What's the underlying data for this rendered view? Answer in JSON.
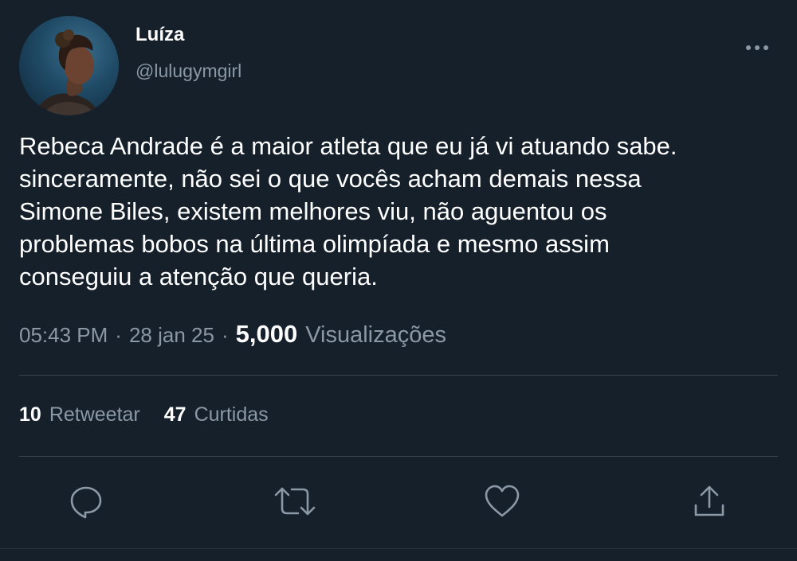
{
  "author": {
    "display_name": "Luíza",
    "handle": "@lulugymgirl"
  },
  "tweet": {
    "text": "Rebeca Andrade é a maior atleta que eu já vi atuando sabe.\nsinceramente, não sei o que vocês acham demais nessa\nSimone Biles, existem melhores viu, não aguentou os\nproblemas bobos na última olimpíada e mesmo assim\nconseguiu a atenção que queria.",
    "time": "05:43 PM",
    "date": "28 jan 25",
    "separator": "·",
    "views_count": "5,000",
    "views_label": "Visualizações"
  },
  "stats": {
    "retweets_count": "10",
    "retweets_label": "Retweetar",
    "likes_count": "47",
    "likes_label": "Curtidas"
  },
  "icons": {
    "more": "more-horizontal-icon",
    "reply": "reply-icon",
    "retweet": "retweet-icon",
    "like": "heart-icon",
    "share": "share-icon"
  },
  "colors": {
    "background": "#15202b",
    "primary_text": "#ffffff",
    "secondary_text": "#8b98a5",
    "divider": "#38444d"
  }
}
